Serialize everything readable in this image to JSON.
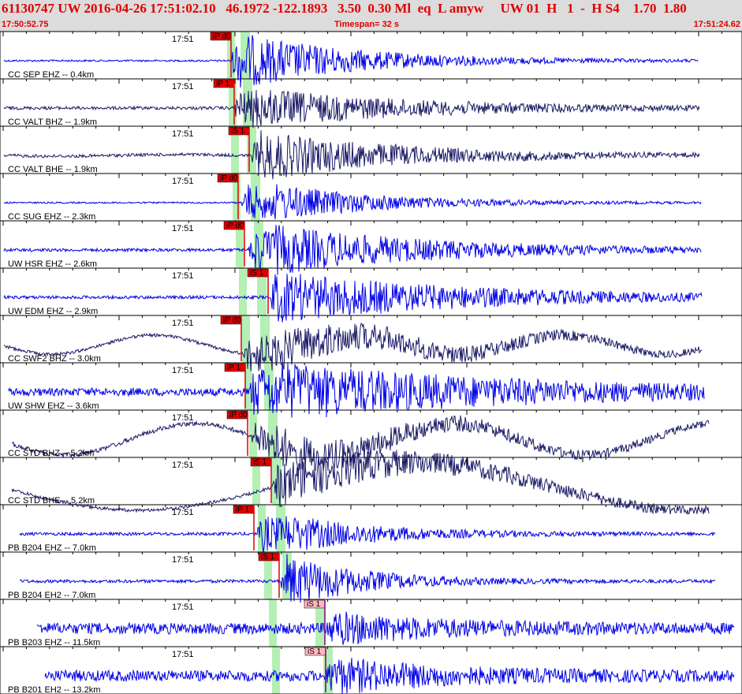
{
  "header": {
    "line1": "61130747 UW 2016-04-26 17:51:02.10   46.1972 -122.1893   3.50  0.30 Ml  eq  L amyw     UW 01  H   1  -  H S4    1.70  1.80",
    "start_time": "17:50:52.75",
    "timespan": "Timespan=  32 s",
    "end_time": "17:51:24.62"
  },
  "colors": {
    "header_text": "#e00000",
    "header_bg": "#dcdcdc",
    "trace_blue": "#0000e6",
    "trace_navy": "#1a1a66",
    "highlight": "#b4f0b4",
    "pick_flag": "#e00000",
    "pick_flag_s": "#ffb6c1"
  },
  "time_label": "17:51",
  "traces": [
    {
      "label": "CC SEP EHZ -- 0.4km",
      "color": "blue",
      "picks": [
        "iP d0"
      ]
    },
    {
      "label": "CC VALT BHZ -- 1.9km",
      "color": "navy",
      "picks": [
        "iP 1"
      ]
    },
    {
      "label": "CC VALT BHE -- 1.9km",
      "color": "navy",
      "picks": [
        "iS 1"
      ]
    },
    {
      "label": "CC SUG EHZ -- 2.3km",
      "color": "blue",
      "picks": [
        "iP d0"
      ]
    },
    {
      "label": "UW HSR EHZ -- 2.6km",
      "color": "blue",
      "picks": [
        "iP d0"
      ]
    },
    {
      "label": "UW EDM EHZ -- 2.9km",
      "color": "blue",
      "picks": [
        "iS 1"
      ]
    },
    {
      "label": "CC SWF2 BHZ -- 3.0km",
      "color": "navy",
      "picks": [
        "iP d0"
      ]
    },
    {
      "label": "UW SHW EHZ -- 3.6km",
      "color": "blue",
      "picks": [
        "iP 1"
      ]
    },
    {
      "label": "CC STD BHZ -- 5.2km",
      "color": "navy",
      "picks": [
        "iP d0"
      ]
    },
    {
      "label": "CC STD BHE -- 5.2km",
      "color": "navy",
      "picks": [
        "iS 1"
      ]
    },
    {
      "label": "PB B204 EHZ -- 7.0km",
      "color": "blue",
      "picks": [
        "iP 1"
      ]
    },
    {
      "label": "PB B204 EH2 -- 7.0km",
      "color": "blue",
      "picks": [
        "iS 1"
      ]
    },
    {
      "label": "PB B203 EHZ -- 11.5km",
      "color": "blue",
      "picks": [
        "iS 1"
      ]
    },
    {
      "label": "PB B201 EH2 -- 13.2km",
      "color": "blue",
      "picks": [
        "iS 1"
      ]
    }
  ]
}
